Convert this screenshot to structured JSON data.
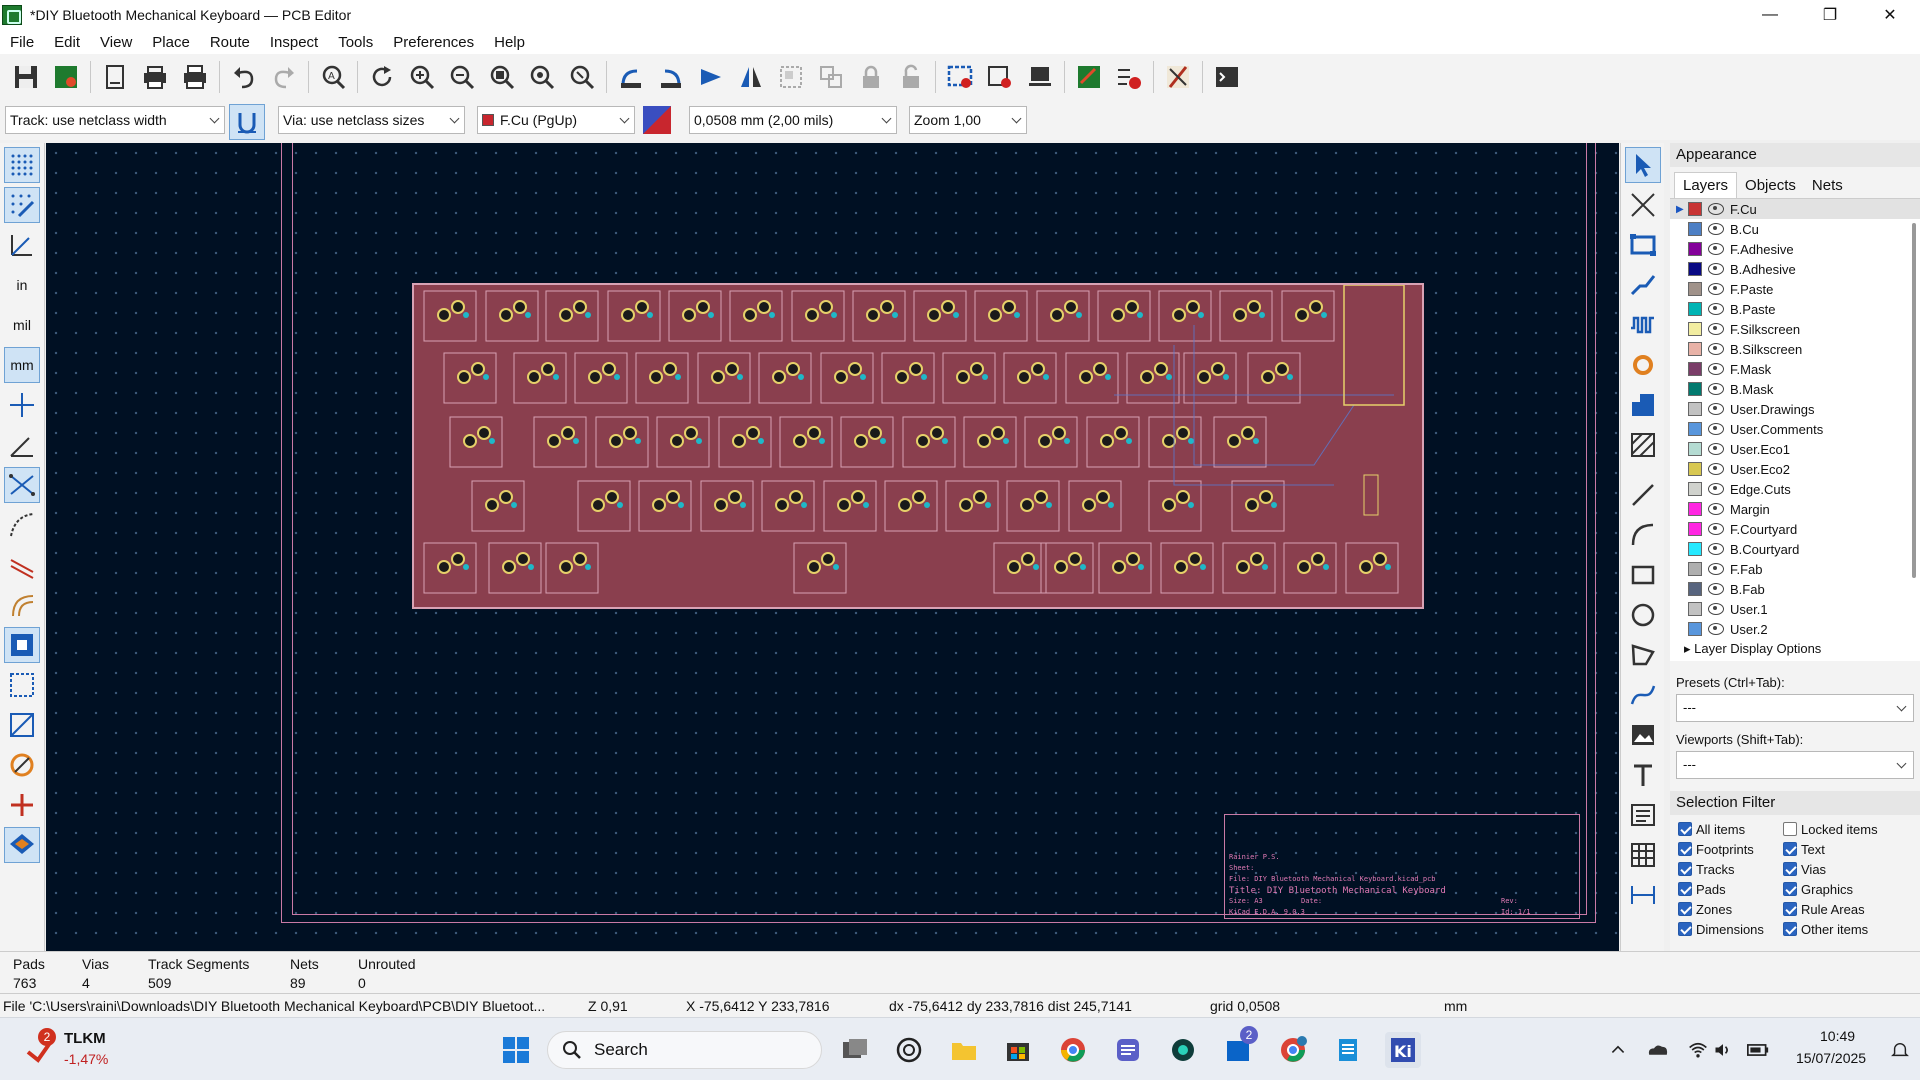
{
  "window": {
    "title": "*DIY Bluetooth Mechanical Keyboard — PCB Editor",
    "minimize": "—",
    "maximize": "❐",
    "close": "✕"
  },
  "menu": [
    "File",
    "Edit",
    "View",
    "Place",
    "Route",
    "Inspect",
    "Tools",
    "Preferences",
    "Help"
  ],
  "toolbar_icons": [
    "save-icon",
    "board-setup-icon",
    "page-settings-icon",
    "print-icon",
    "plot-icon",
    "undo-icon",
    "redo-icon",
    "find-icon",
    "refresh-icon",
    "zoom-in-icon",
    "zoom-out-icon",
    "zoom-fit-icon",
    "zoom-objects-icon",
    "zoom-selection-icon",
    "rotate-ccw-icon",
    "rotate-cw-icon",
    "flip-icon",
    "mirror-icon",
    "group-icon",
    "ungroup-icon",
    "lock-icon",
    "unlock-icon",
    "update-pcb-icon",
    "footprint-editor-icon",
    "footprint-browser-icon",
    "scripting-icon",
    "drc-icon",
    "router-icon",
    "console-icon"
  ],
  "aux": {
    "track": "Track: use netclass width",
    "via": "Via: use netclass sizes",
    "layer": "F.Cu (PgUp)",
    "layer_color": "#c8262e",
    "grid": "0,0508 mm (2,00 mils)",
    "zoom": "Zoom 1,00"
  },
  "left_toolbar": {
    "units_in": "in",
    "units_mil": "mil",
    "units_mm": "mm"
  },
  "title_block": {
    "company": "Rainier P.S.",
    "sheet": "Sheet:",
    "file": "File: DIY Bluetooth Mechanical Keyboard.kicad_pcb",
    "title": "Title: DIY Bluetooth Mechanical Keyboard",
    "size": "Size: A3",
    "date": "Date:",
    "rev": "Rev:",
    "kicad": "KiCad E.D.A. 9.0.3",
    "id": "Id: 1/1"
  },
  "appearance": {
    "title": "Appearance",
    "tabs": [
      "Layers",
      "Objects",
      "Nets"
    ],
    "layers": [
      {
        "name": "F.Cu",
        "color": "#c83434"
      },
      {
        "name": "B.Cu",
        "color": "#4d7fc4"
      },
      {
        "name": "F.Adhesive",
        "color": "#84009a"
      },
      {
        "name": "B.Adhesive",
        "color": "#0a0a84"
      },
      {
        "name": "F.Paste",
        "color": "#a0928a"
      },
      {
        "name": "B.Paste",
        "color": "#00b4b4"
      },
      {
        "name": "F.Silkscreen",
        "color": "#f2eda1"
      },
      {
        "name": "B.Silkscreen",
        "color": "#e8b2a7"
      },
      {
        "name": "F.Mask",
        "color": "#7a3d68"
      },
      {
        "name": "B.Mask",
        "color": "#027a6f"
      },
      {
        "name": "User.Drawings",
        "color": "#c2c2c2"
      },
      {
        "name": "User.Comments",
        "color": "#5996dc"
      },
      {
        "name": "User.Eco1",
        "color": "#b4dbd2"
      },
      {
        "name": "User.Eco2",
        "color": "#d8c852"
      },
      {
        "name": "Edge.Cuts",
        "color": "#d0d2cd"
      },
      {
        "name": "Margin",
        "color": "#ff26e2"
      },
      {
        "name": "F.Courtyard",
        "color": "#ff26e2"
      },
      {
        "name": "B.Courtyard",
        "color": "#26e9ff"
      },
      {
        "name": "F.Fab",
        "color": "#afafaf"
      },
      {
        "name": "B.Fab",
        "color": "#58657f"
      },
      {
        "name": "User.1",
        "color": "#c2c2c2"
      },
      {
        "name": "User.2",
        "color": "#5996dc"
      }
    ],
    "layer_display_options": "Layer Display Options",
    "presets_label": "Presets (Ctrl+Tab):",
    "presets_value": "---",
    "viewports_label": "Viewports (Shift+Tab):",
    "viewports_value": "---"
  },
  "selection_filter": {
    "title": "Selection Filter",
    "items": [
      {
        "label": "All items",
        "checked": true
      },
      {
        "label": "Locked items",
        "checked": false
      },
      {
        "label": "Footprints",
        "checked": true
      },
      {
        "label": "Text",
        "checked": true
      },
      {
        "label": "Tracks",
        "checked": true
      },
      {
        "label": "Vias",
        "checked": true
      },
      {
        "label": "Pads",
        "checked": true
      },
      {
        "label": "Graphics",
        "checked": true
      },
      {
        "label": "Zones",
        "checked": true
      },
      {
        "label": "Rule Areas",
        "checked": true
      },
      {
        "label": "Dimensions",
        "checked": true
      },
      {
        "label": "Other items",
        "checked": true
      }
    ]
  },
  "stats": {
    "pads_label": "Pads",
    "pads": "763",
    "vias_label": "Vias",
    "vias": "4",
    "tracks_label": "Track Segments",
    "tracks": "509",
    "nets_label": "Nets",
    "nets": "89",
    "unrouted_label": "Unrouted",
    "unrouted": "0"
  },
  "status": {
    "file": "File 'C:\\Users\\raini\\Downloads\\DIY Bluetooth Mechanical Keyboard\\PCB\\DIY Bluetoot...",
    "z": "Z 0,91",
    "xy": "X -75,6412  Y 233,7816",
    "delta": "dx -75,6412  dy 233,7816  dist 245,7141",
    "grid": "grid 0,0508",
    "units": "mm"
  },
  "taskbar": {
    "stock_name": "TLKM",
    "stock_change": "-1,47%",
    "stock_badge": "2",
    "search": "Search",
    "mail_badge": "2",
    "time": "10:49",
    "date": "15/07/2025"
  }
}
